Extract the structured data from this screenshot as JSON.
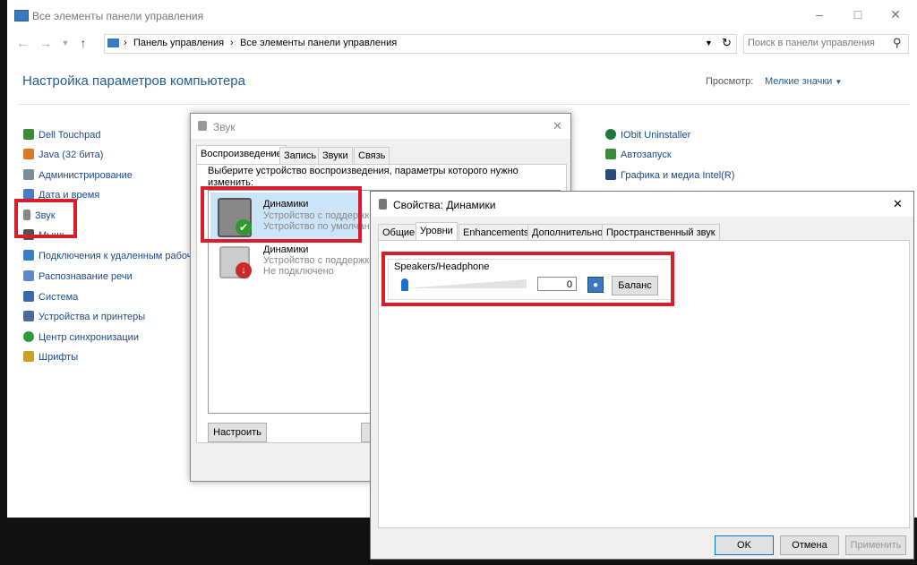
{
  "cp": {
    "window_title": "Все элементы панели управления",
    "breadcrumb": [
      "Панель управления",
      "Все элементы панели управления"
    ],
    "search_placeholder": "Поиск в панели управления",
    "heading": "Настройка параметров компьютера",
    "view_label": "Просмотр:",
    "view_value": "Мелкие значки",
    "left_items": [
      {
        "label": "Dell Touchpad",
        "color": "#3a8a3a"
      },
      {
        "label": "Java (32 бита)",
        "color": "#d9782a"
      },
      {
        "label": "Администрирование",
        "color": "#7a8a99"
      },
      {
        "label": "Дата и время",
        "color": "#4a7cc7"
      },
      {
        "label": "Звук",
        "color": "#888888"
      },
      {
        "label": "Мышь",
        "color": "#555555"
      },
      {
        "label": "Подключения к удаленным рабочим",
        "color": "#3a7ac7"
      },
      {
        "label": "Распознавание речи",
        "color": "#5a8ac7"
      },
      {
        "label": "Система",
        "color": "#3a6aa7"
      },
      {
        "label": "Устройства и принтеры",
        "color": "#4a6a97"
      },
      {
        "label": "Центр синхронизации",
        "color": "#2a9a3a"
      },
      {
        "label": "Шрифты",
        "color": "#c9a227"
      }
    ],
    "right_items": [
      {
        "label": "IObit Uninstaller",
        "color": "#1a7a3a"
      },
      {
        "label": "Автозапуск",
        "color": "#3a8a3a"
      },
      {
        "label": "Графика и медиа Intel(R)",
        "color": "#2a4a7a"
      }
    ]
  },
  "sound": {
    "title": "Звук",
    "tabs": [
      "Воспроизведение",
      "Запись",
      "Звуки",
      "Связь"
    ],
    "instruction": "Выберите устройство воспроизведения, параметры которого нужно изменить:",
    "devices": [
      {
        "name": "Динамики",
        "line1": "Устройство с поддержкой",
        "line2": "Устройство по умолчанию"
      },
      {
        "name": "Динамики",
        "line1": "Устройство с поддержкой",
        "line2": "Не подключено"
      }
    ],
    "configure": "Настроить"
  },
  "props": {
    "title": "Свойства: Динамики",
    "tabs": [
      "Общие",
      "Уровни",
      "Enhancements",
      "Дополнительно",
      "Пространственный звук"
    ],
    "group_label": "Speakers/Headphone",
    "volume_value": "0",
    "volume_level": 0,
    "balance": "Баланс",
    "ok": "OK",
    "cancel": "Отмена",
    "apply": "Применить",
    "highlight_color": "#d61f2b"
  }
}
